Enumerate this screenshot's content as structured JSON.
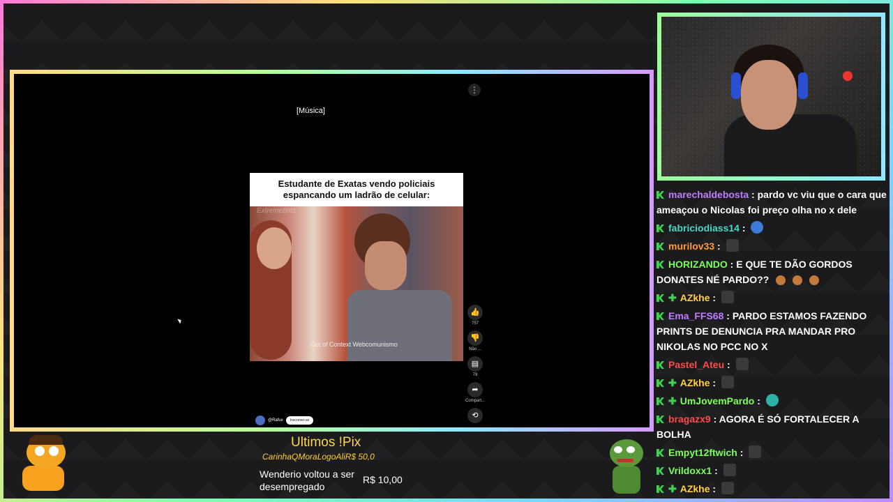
{
  "video": {
    "music_caption": "[Música]",
    "meme_caption": "Estudante de Exatas vendo policiais espancando um ladrão de celular:",
    "watermark": "ExtremeBlitz",
    "overlay_text": "Out of Context Webcomunismo",
    "actions": [
      {
        "icon": "thumbs-up-icon",
        "label": "757"
      },
      {
        "icon": "thumbs-down-icon",
        "label": "Não ..."
      },
      {
        "icon": "comment-icon",
        "label": "79"
      },
      {
        "icon": "share-icon",
        "label": "Compart..."
      },
      {
        "icon": "remix-icon",
        "label": ""
      }
    ],
    "channel": "@Rafux",
    "subscribe": "Inscrever-se"
  },
  "chat": {
    "messages": [
      {
        "user": "marechaldebosta",
        "color": "#c07cff",
        "badges": "k",
        "text": "pardo vc viu que o cara que ameaçou o Nicolas foi preço olha no x dele",
        "emote": ""
      },
      {
        "user": "fabriciodiass14",
        "color": "#46d9c2",
        "badges": "k",
        "text": "",
        "emote": "blue"
      },
      {
        "user": "murilov33",
        "color": "#ff9a3c",
        "badges": "k",
        "text": "",
        "emote": "grey"
      },
      {
        "user": "HORIZANDO",
        "color": "#7dff5a",
        "badges": "k",
        "text": "E QUE TE DÃO GORDOS DONATES NÉ PARDO??",
        "emote": "donuts"
      },
      {
        "user": "AZkhe",
        "color": "#ffcf4a",
        "badges": "k+",
        "text": "",
        "emote": "grey"
      },
      {
        "user": "Ema_FFS68",
        "color": "#c07cff",
        "badges": "k",
        "text": "PARDO ESTAMOS FAZENDO PRINTS DE DENUNCIA PRA MANDAR PRO NIKOLAS NO PCC NO X",
        "emote": ""
      },
      {
        "user": "Pastel_Ateu",
        "color": "#ff4a4a",
        "badges": "k",
        "text": "",
        "emote": "grey"
      },
      {
        "user": "AZkhe",
        "color": "#ffcf4a",
        "badges": "k+",
        "text": "",
        "emote": "grey"
      },
      {
        "user": "UmJovemPardo",
        "color": "#7dff5a",
        "badges": "k+",
        "text": "",
        "emote": "teal"
      },
      {
        "user": "bragazx9",
        "color": "#ff4a4a",
        "badges": "k",
        "text": "AGORA É SÓ FORTALECER A BOLHA",
        "emote": ""
      },
      {
        "user": "Empyt12ftwich",
        "color": "#7dff5a",
        "badges": "k",
        "text": "",
        "emote": "grey"
      },
      {
        "user": "Vrildoxx1",
        "color": "#7dff5a",
        "badges": "k",
        "text": "",
        "emote": "grey"
      },
      {
        "user": "AZkhe",
        "color": "#ffcf4a",
        "badges": "k+",
        "text": "",
        "emote": "grey"
      }
    ]
  },
  "pix": {
    "title": "Ultimos !Pix",
    "scroll_text": "CarinhaQMoraLogoAliR$ 50,0",
    "message": "Wenderio voltou a ser desempregado",
    "amount": "R$ 10,00"
  }
}
